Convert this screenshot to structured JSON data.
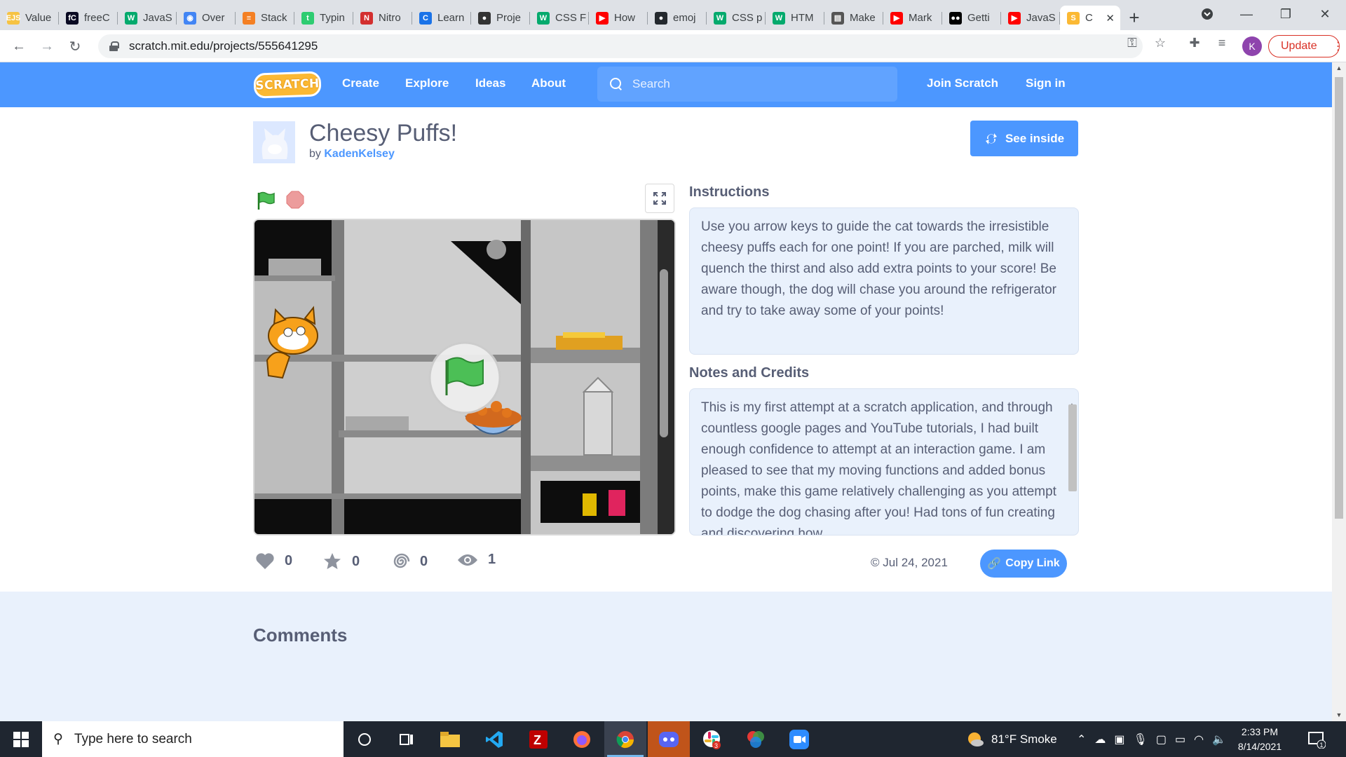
{
  "browser": {
    "tabs": [
      {
        "title": "Value",
        "icon": "ejs-icon",
        "color": "#f6c343",
        "glyph": "EJS"
      },
      {
        "title": "freeC",
        "icon": "freecodecamp-icon",
        "color": "#0a0a23",
        "glyph": "fC"
      },
      {
        "title": "JavaS",
        "icon": "w3schools-icon",
        "color": "#04aa6d",
        "glyph": "W"
      },
      {
        "title": "Over",
        "icon": "chrome-icon",
        "color": "#4285f4",
        "glyph": "◉"
      },
      {
        "title": "Stack",
        "icon": "stackoverflow-icon",
        "color": "#f48024",
        "glyph": "≡"
      },
      {
        "title": "Typin",
        "icon": "typing-icon",
        "color": "#2ecc71",
        "glyph": "t"
      },
      {
        "title": "Nitro",
        "icon": "nitro-icon",
        "color": "#d32f2f",
        "glyph": "N"
      },
      {
        "title": "Learn",
        "icon": "learn-icon",
        "color": "#1a73e8",
        "glyph": "C"
      },
      {
        "title": "Proje",
        "icon": "project-icon",
        "color": "#333333",
        "glyph": "●"
      },
      {
        "title": "CSS F",
        "icon": "w3schools-icon",
        "color": "#04aa6d",
        "glyph": "W"
      },
      {
        "title": "How",
        "icon": "youtube-icon",
        "color": "#ff0000",
        "glyph": "▶"
      },
      {
        "title": "emoj",
        "icon": "github-icon",
        "color": "#24292e",
        "glyph": "●"
      },
      {
        "title": "CSS p",
        "icon": "w3schools-icon",
        "color": "#04aa6d",
        "glyph": "W"
      },
      {
        "title": "HTM",
        "icon": "w3schools-icon",
        "color": "#04aa6d",
        "glyph": "W"
      },
      {
        "title": "Make",
        "icon": "document-icon",
        "color": "#555555",
        "glyph": "▤"
      },
      {
        "title": "Mark",
        "icon": "youtube-icon",
        "color": "#ff0000",
        "glyph": "▶"
      },
      {
        "title": "Getti",
        "icon": "medium-icon",
        "color": "#000000",
        "glyph": "●●"
      },
      {
        "title": "JavaS",
        "icon": "youtube-icon",
        "color": "#ff0000",
        "glyph": "▶"
      }
    ],
    "active_tab": {
      "title": "C",
      "icon": "scratch-icon",
      "color": "#fbb934",
      "glyph": "S"
    },
    "url": "scratch.mit.edu/projects/555641295",
    "profile_initial": "K",
    "update_label": "Update"
  },
  "scratch": {
    "logo_text": "SCRATCH",
    "nav": {
      "create": "Create",
      "explore": "Explore",
      "ideas": "Ideas",
      "about": "About"
    },
    "search_placeholder": "Search",
    "join": "Join Scratch",
    "signin": "Sign in",
    "accent": "#4c97ff"
  },
  "project": {
    "title": "Cheesy Puffs!",
    "by_prefix": "by",
    "author": "KadenKelsey",
    "see_inside": "See inside",
    "instructions_heading": "Instructions",
    "instructions_text": "Use you arrow keys to guide the cat towards the irresistible cheesy puffs each for one point! If you are parched, milk will quench the thirst and also add extra points to your score! Be aware though, the dog will chase you around the refrigerator and try to take away some of your points!",
    "notes_heading": "Notes and Credits",
    "notes_text": "This is my first attempt at a scratch application, and through countless google pages and YouTube tutorials, I had built enough confidence to attempt at an interaction game. I am pleased to see that my moving functions and added bonus points, make this game relatively challenging as you attempt to dodge the dog chasing after you! Had tons of fun creating and discovering how",
    "stats": {
      "loves": "0",
      "favorites": "0",
      "remixes": "0",
      "views": "1"
    },
    "date": "Jul 24, 2021",
    "copy_link": "Copy Link",
    "comments_heading": "Comments"
  },
  "taskbar": {
    "search_placeholder": "Type here to search",
    "weather": "81°F  Smoke",
    "time": "2:33 PM",
    "date": "8/14/2021",
    "notification_count": "1",
    "slack_badge": "3"
  }
}
